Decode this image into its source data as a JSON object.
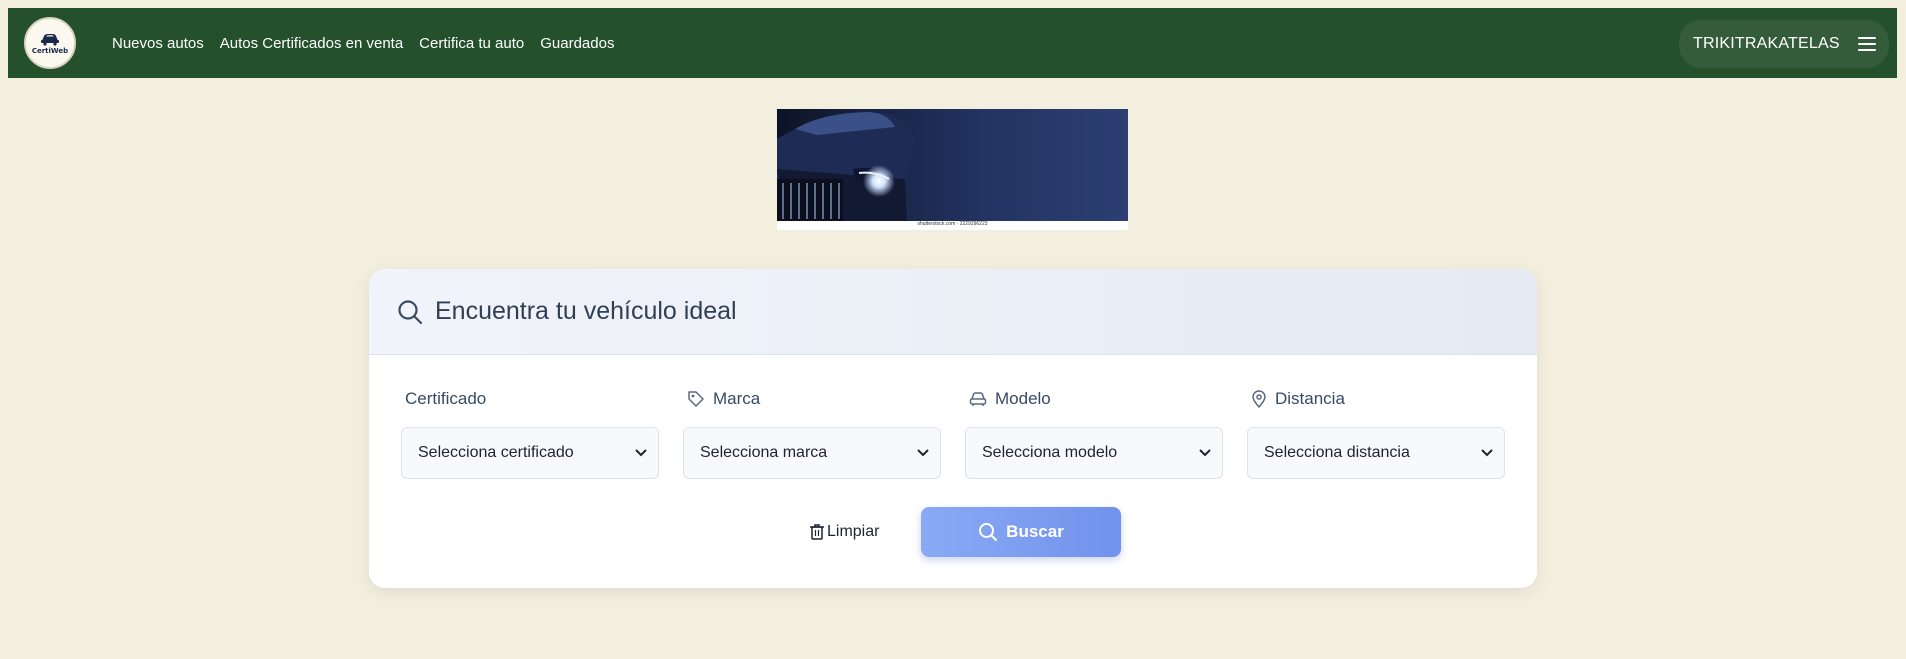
{
  "nav": {
    "logo_text": "CertiWeb",
    "links": [
      "Nuevos autos",
      "Autos Certificados en venta",
      "Certifica tu auto",
      "Guardados"
    ],
    "user_name": "TRIKITRAKATELAS",
    "menu_icon": "hamburger-icon"
  },
  "banner": {
    "caption": "shutterstock.com · 2229296223"
  },
  "search": {
    "title": "Encuentra tu vehículo ideal",
    "filters": [
      {
        "label": "Certificado",
        "icon": "",
        "placeholder": "Selecciona certificado"
      },
      {
        "label": "Marca",
        "icon": "tag-icon",
        "placeholder": "Selecciona marca"
      },
      {
        "label": "Modelo",
        "icon": "car-icon",
        "placeholder": "Selecciona modelo"
      },
      {
        "label": "Distancia",
        "icon": "location-pin-icon",
        "placeholder": "Selecciona distancia"
      }
    ],
    "clear_label": "Limpiar",
    "search_label": "Buscar"
  },
  "colors": {
    "navbar": "#24502c",
    "page_bg": "#f3efdf",
    "accent": "#7192ec"
  }
}
